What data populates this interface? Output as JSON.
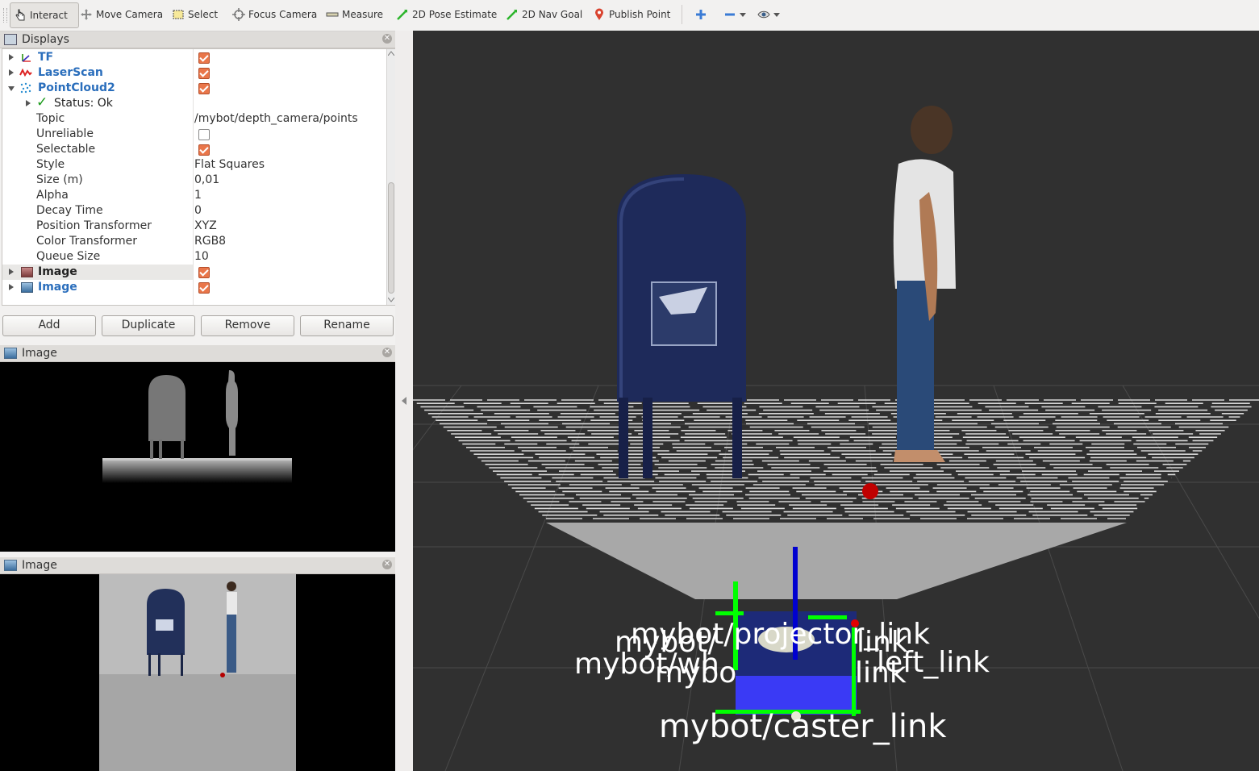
{
  "toolbar": {
    "tools": [
      "Interact",
      "Move Camera",
      "Select",
      "Focus Camera",
      "Measure",
      "2D Pose Estimate",
      "2D Nav Goal",
      "Publish Point"
    ],
    "extra_icons": [
      "plus-icon",
      "minus-icon",
      "eye-icon"
    ]
  },
  "displays": {
    "title": "Displays",
    "items": [
      {
        "label": "TF",
        "color": "blue",
        "checked": true
      },
      {
        "label": "LaserScan",
        "color": "blue",
        "checked": true
      },
      {
        "label": "PointCloud2",
        "color": "blue",
        "checked": true
      }
    ],
    "pointcloud": {
      "status": "Status: Ok",
      "props": [
        {
          "name": "Topic",
          "value": "/mybot/depth_camera/points"
        },
        {
          "name": "Unreliable",
          "value": ""
        },
        {
          "name": "Selectable",
          "value": ""
        },
        {
          "name": "Style",
          "value": "Flat Squares"
        },
        {
          "name": "Size (m)",
          "value": "0,01"
        },
        {
          "name": "Alpha",
          "value": "1"
        },
        {
          "name": "Decay Time",
          "value": "0"
        },
        {
          "name": "Position Transformer",
          "value": "XYZ"
        },
        {
          "name": "Color Transformer",
          "value": "RGB8"
        },
        {
          "name": "Queue Size",
          "value": "10"
        }
      ]
    },
    "image_items": [
      {
        "label": "Image",
        "checked": true
      },
      {
        "label": "Image",
        "checked": true
      }
    ],
    "buttons": {
      "add": "Add",
      "duplicate": "Duplicate",
      "remove": "Remove",
      "rename": "Rename"
    }
  },
  "image_panels": [
    {
      "title": "Image"
    },
    {
      "title": "Image"
    }
  ],
  "scene_labels": {
    "projector": "mybot/projector_link",
    "caster": "mybot/caster_link",
    "left": "left_link",
    "overlap_top": "mybot/",
    "overlap_mid": "mybot/wh",
    "overlap_low": "mybo",
    "overlap_link": "link",
    "overlap_link2": "link"
  }
}
